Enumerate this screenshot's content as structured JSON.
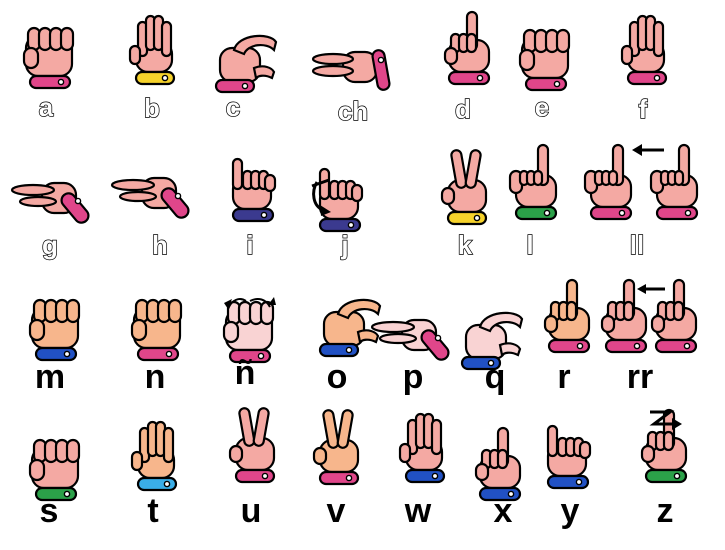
{
  "colors": {
    "skin": "#f4a9a3",
    "skin_orange": "#f7b68c",
    "skin_light": "#f9d3d3",
    "pink": "#e0468a",
    "yellow": "#f6d22b",
    "navy": "#3b3a8f",
    "green": "#2ba149",
    "blue": "#2151c4",
    "lightblue": "#3aaee8"
  },
  "signs": [
    {
      "key": "a",
      "label": "a",
      "cuff": "pink",
      "shape": "fist"
    },
    {
      "key": "b",
      "label": "b",
      "cuff": "yellow",
      "shape": "flat"
    },
    {
      "key": "c",
      "label": "c",
      "cuff": "pink",
      "shape": "c"
    },
    {
      "key": "ch",
      "label": "ch",
      "cuff": "pink",
      "shape": "point-right"
    },
    {
      "key": "d",
      "label": "d",
      "cuff": "pink",
      "shape": "index-up"
    },
    {
      "key": "e",
      "label": "e",
      "cuff": "pink",
      "shape": "fist"
    },
    {
      "key": "f",
      "label": "f",
      "cuff": "pink",
      "shape": "flat"
    },
    {
      "key": "g",
      "label": "g",
      "cuff": "pink",
      "shape": "point-left"
    },
    {
      "key": "h",
      "label": "h",
      "cuff": "pink",
      "shape": "point-left"
    },
    {
      "key": "i",
      "label": "i",
      "cuff": "navy",
      "shape": "pinky-up"
    },
    {
      "key": "j",
      "label": "j",
      "cuff": "navy",
      "shape": "pinky-up"
    },
    {
      "key": "k",
      "label": "k",
      "cuff": "yellow",
      "shape": "v"
    },
    {
      "key": "l",
      "label": "l",
      "cuff": "green",
      "shape": "l"
    },
    {
      "key": "ll",
      "label": "ll",
      "cuff": "pink",
      "shape": "l"
    },
    {
      "key": "m",
      "label": "m",
      "cuff": "blue",
      "shape": "fist"
    },
    {
      "key": "n",
      "label": "n",
      "cuff": "pink",
      "shape": "fist"
    },
    {
      "key": "enie",
      "label": "ñ",
      "cuff": "pink",
      "shape": "fist"
    },
    {
      "key": "o",
      "label": "o",
      "cuff": "blue",
      "shape": "c"
    },
    {
      "key": "p",
      "label": "p",
      "cuff": "pink",
      "shape": "point-left"
    },
    {
      "key": "q",
      "label": "q",
      "cuff": "blue",
      "shape": "c"
    },
    {
      "key": "r",
      "label": "r",
      "cuff": "pink",
      "shape": "index-up"
    },
    {
      "key": "rr",
      "label": "rr",
      "cuff": "pink",
      "shape": "index-up"
    },
    {
      "key": "s",
      "label": "s",
      "cuff": "green",
      "shape": "fist"
    },
    {
      "key": "t",
      "label": "t",
      "cuff": "lightblue",
      "shape": "flat"
    },
    {
      "key": "u",
      "label": "u",
      "cuff": "pink",
      "shape": "v"
    },
    {
      "key": "v",
      "label": "v",
      "cuff": "pink",
      "shape": "v"
    },
    {
      "key": "w",
      "label": "w",
      "cuff": "blue",
      "shape": "flat"
    },
    {
      "key": "x",
      "label": "x",
      "cuff": "blue",
      "shape": "index-up"
    },
    {
      "key": "y",
      "label": "y",
      "cuff": "blue",
      "shape": "pinky-up"
    },
    {
      "key": "z",
      "label": "z",
      "cuff": "green",
      "shape": "index-up"
    }
  ]
}
